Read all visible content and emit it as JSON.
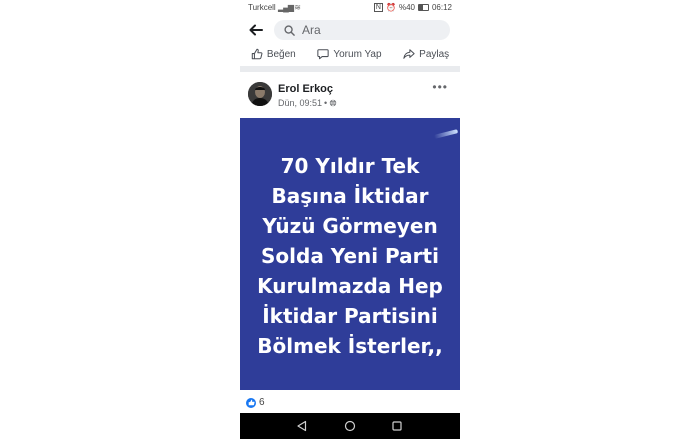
{
  "status_bar": {
    "carrier": "Turkcell",
    "battery": "%40",
    "time": "06:12"
  },
  "search": {
    "placeholder": "Ara"
  },
  "actions": {
    "like": "Beğen",
    "comment": "Yorum Yap",
    "share": "Paylaş"
  },
  "post": {
    "author": "Erol Erkoç",
    "timestamp": "Dün, 09:51",
    "separator": "•",
    "more": "•••",
    "image_lines": [
      "70 Yıldır Tek",
      "Başına İktidar",
      "Yüzü Görmeyen",
      "Solda Yeni Parti",
      "Kurulmazda Hep",
      "İktidar Partisini",
      "Bölmek İsterler,,"
    ],
    "image_bg_color": "#2f3d99",
    "reaction_count": "6"
  },
  "icons": {
    "back": "arrow-left-icon",
    "search": "search-icon",
    "like": "thumbs-up-icon",
    "comment": "comment-icon",
    "share": "share-icon",
    "globe": "globe-icon",
    "nav_back": "triangle-back-icon",
    "nav_home": "circle-home-icon",
    "nav_recents": "square-recents-icon"
  }
}
